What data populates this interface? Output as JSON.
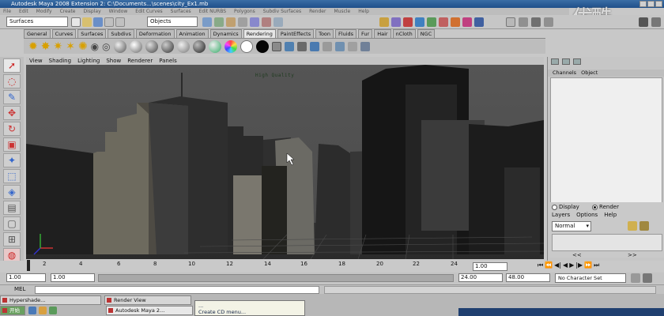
{
  "window": {
    "title": "Autodesk Maya 2008 Extension 2: C:\\Documents...\\scenes\\city_Ex1.mb"
  },
  "menubar": {
    "items": [
      "File",
      "Edit",
      "Modify",
      "Create",
      "Display",
      "Window",
      "Edit Curves",
      "Surfaces",
      "Edit NURBS",
      "Polygons",
      "Subdiv Surfaces",
      "Render",
      "Muscle",
      "Help"
    ]
  },
  "statusline": {
    "mode": "Surfaces",
    "selection_mode": "Objects"
  },
  "shelf_tabs": [
    "General",
    "Curves",
    "Surfaces",
    "Subdivs",
    "Deformation",
    "Animation",
    "Dynamics",
    "Rendering",
    "PaintEffects",
    "Toon",
    "Fluids",
    "Fur",
    "Hair",
    "nCloth",
    "NGC"
  ],
  "active_shelf_tab": "Rendering",
  "panel_menu": [
    "View",
    "Shading",
    "Lighting",
    "Show",
    "Renderer",
    "Panels"
  ],
  "viewport": {
    "label": "High Quality"
  },
  "channel_box": {
    "menu": [
      "Channels",
      "Object"
    ]
  },
  "layer_editor": {
    "display_label": "Display",
    "render_label": "Render",
    "menu": [
      "Layers",
      "Options",
      "Help"
    ],
    "layer_type": "Normal"
  },
  "timeline": {
    "ticks": [
      "2",
      "4",
      "6",
      "8",
      "10",
      "12",
      "14",
      "16",
      "18",
      "20",
      "22",
      "24"
    ],
    "current_frame": "1.00"
  },
  "range": {
    "start_time": "1.00",
    "playback_start": "1.00",
    "playback_end": "24.00",
    "end_time": "48.00",
    "character_set": "No Character Set"
  },
  "command_line": {
    "label": "MEL"
  },
  "taskbar": {
    "items": [
      "Hypershade...",
      "Render View",
      "Autodesk Maya 2..."
    ],
    "start_label": "开始",
    "tooltip_line1": "...",
    "tooltip_line2": "Create CD menu..."
  },
  "watermark": "优酷",
  "colors": {
    "title_blue": "#1f4f8a",
    "viewport_sky": "#555555",
    "building": "#2a2a2a"
  }
}
